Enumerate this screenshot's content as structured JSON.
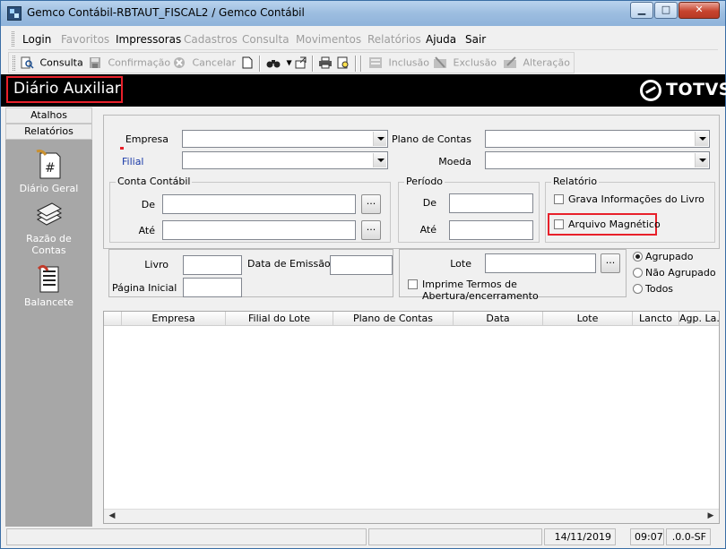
{
  "window": {
    "title": "Gemco Contábil-RBTAUT_FISCAL2 / Gemco Contábil"
  },
  "menu": {
    "items": [
      {
        "label": "Login",
        "enabled": true
      },
      {
        "label": "Favoritos",
        "enabled": false
      },
      {
        "label": "Impressoras",
        "enabled": true
      },
      {
        "label": "Cadastros",
        "enabled": false
      },
      {
        "label": "Consulta",
        "enabled": false
      },
      {
        "label": "Movimentos",
        "enabled": false
      },
      {
        "label": "Relatórios",
        "enabled": false
      },
      {
        "label": "Ajuda",
        "enabled": true
      },
      {
        "label": "Sair",
        "enabled": true
      }
    ]
  },
  "toolbar": {
    "consulta": "Consulta",
    "confirmacao": "Confirmação",
    "cancelar": "Cancelar",
    "inclusao": "Inclusão",
    "exclusao": "Exclusão",
    "alteracao": "Alteração"
  },
  "header": {
    "page_title": "Diário Auxiliar",
    "brand": "TOTVS"
  },
  "sidebar": {
    "tabs": [
      "Atalhos",
      "Relatórios"
    ],
    "items": [
      {
        "label": "Diário Geral",
        "icon": "document-hash-icon"
      },
      {
        "label": "Razão de Contas",
        "icon": "book-stack-icon"
      },
      {
        "label": "Balancete",
        "icon": "ledger-icon"
      }
    ]
  },
  "form": {
    "empresa_label": "Empresa",
    "filial_label": "Filial",
    "plano_label": "Plano de Contas",
    "moeda_label": "Moeda",
    "conta_contabil": {
      "title": "Conta Contábil",
      "de_label": "De",
      "ate_label": "Até"
    },
    "periodo": {
      "title": "Período",
      "de_label": "De",
      "ate_label": "Até"
    },
    "relatorio": {
      "title": "Relatório",
      "grava_label": "Grava Informações do Livro",
      "arquivo_label": "Arquivo Magnético"
    },
    "livro_label": "Livro",
    "data_emissao_label": "Data de Emissão",
    "pagina_inicial_label": "Página Inicial",
    "lote_label": "Lote",
    "imprime_termos_label": "Imprime Termos de Abertura/encerramento",
    "agrupamento": {
      "options": [
        "Agrupado",
        "Não Agrupado",
        "Todos"
      ],
      "selected": "Agrupado"
    }
  },
  "grid": {
    "columns": [
      "Empresa",
      "Filial do Lote",
      "Plano de Contas",
      "Data",
      "Lote",
      "Lancto",
      "Agp. La..."
    ]
  },
  "status": {
    "date": "14/11/2019",
    "time": "09:07",
    "version": ".0.0-SF"
  },
  "colors": {
    "highlight": "#e8202a",
    "sidebar_bg": "#a7a7a7",
    "header_bg": "#000000"
  }
}
